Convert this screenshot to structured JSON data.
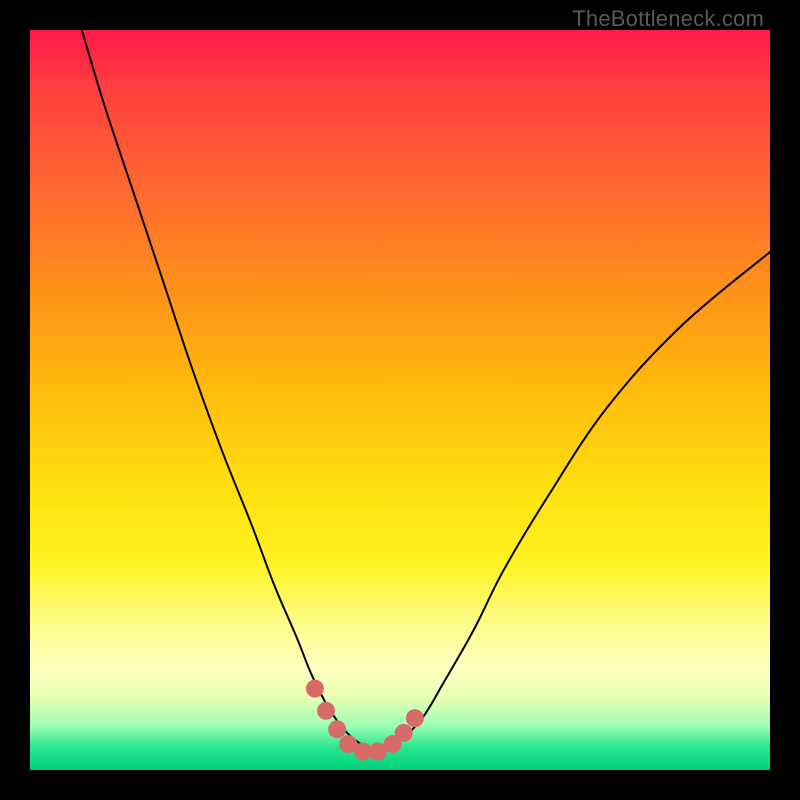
{
  "watermark": "TheBottleneck.com",
  "chart_data": {
    "type": "line",
    "title": "",
    "xlabel": "",
    "ylabel": "",
    "xlim": [
      0,
      100
    ],
    "ylim": [
      0,
      100
    ],
    "grid": false,
    "series": [
      {
        "name": "bottleneck-curve",
        "stroke": "#000000",
        "stroke_width": 2,
        "x": [
          7,
          10,
          14,
          18,
          22,
          26,
          30,
          33,
          36,
          38,
          40,
          42,
          44,
          46,
          48,
          50,
          53,
          56,
          60,
          64,
          70,
          78,
          88,
          100
        ],
        "y": [
          100,
          90,
          78,
          66,
          54,
          43,
          33,
          25,
          18,
          13,
          9,
          6,
          4,
          3,
          3,
          4,
          7,
          12,
          19,
          27,
          37,
          49,
          60,
          70
        ]
      }
    ],
    "markers": {
      "name": "highlight-dots",
      "color": "#d86a6a",
      "radius": 9,
      "x": [
        38.5,
        40,
        41.5,
        43,
        45,
        47,
        49,
        50.5,
        52
      ],
      "y": [
        11,
        8,
        5.5,
        3.5,
        2.5,
        2.5,
        3.5,
        5,
        7
      ]
    },
    "gradient_stops": [
      {
        "pos": 0,
        "color": "#ff1a4a"
      },
      {
        "pos": 22,
        "color": "#ff6a30"
      },
      {
        "pos": 50,
        "color": "#ffbf0c"
      },
      {
        "pos": 72,
        "color": "#fff321"
      },
      {
        "pos": 86,
        "color": "#ffffbe"
      },
      {
        "pos": 97,
        "color": "#27e58e"
      },
      {
        "pos": 100,
        "color": "#00d27a"
      }
    ]
  }
}
